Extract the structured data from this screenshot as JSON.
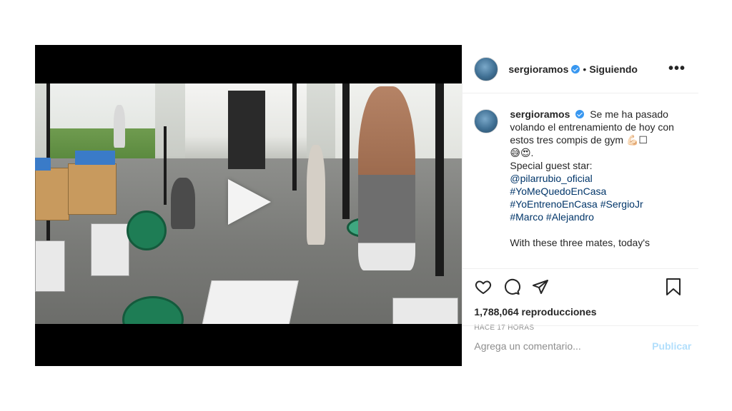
{
  "header": {
    "username": "sergioramos",
    "separator": "•",
    "follow_status": "Siguiendo",
    "more_label": "•••"
  },
  "caption": {
    "username": "sergioramos",
    "line1": "Se me ha pasado volando el entrenamiento de hoy con estos tres compis de gym 💪🏻☐",
    "line2": "😅😍.",
    "line3": "Special guest star:",
    "mention": "@pilarrubio_oficial",
    "tag1": "#YoMeQuedoEnCasa",
    "tag2": "#YoEntrenoEnCasa #SergioJr",
    "tag3": "#Marco #Alejandro",
    "translation": "With these three mates, today's"
  },
  "stats": {
    "views": "1,788,064 reproducciones",
    "time": "HACE 17 HORAS"
  },
  "comment": {
    "placeholder": "Agrega un comentario...",
    "publish_label": "Publicar"
  },
  "icons": [
    "heart-icon",
    "comment-icon",
    "share-icon",
    "bookmark-icon",
    "play-icon",
    "verified-badge-icon"
  ],
  "colors": {
    "verified": "#3897f0",
    "publish_disabled": "#b2dffc",
    "link": "#003569"
  }
}
